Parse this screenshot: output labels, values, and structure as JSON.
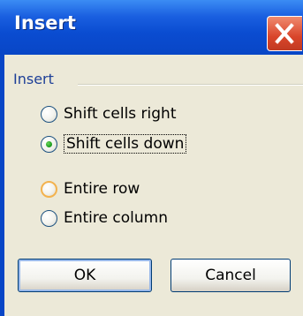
{
  "window": {
    "title": "Insert"
  },
  "titlebar": {
    "close_icon": "close-x-icon"
  },
  "group": {
    "label": "Insert"
  },
  "options": [
    {
      "label": "Shift cells right",
      "selected": false
    },
    {
      "label": "Shift cells down",
      "selected": true
    },
    {
      "label": "Entire row",
      "selected": false
    },
    {
      "label": "Entire column",
      "selected": false
    }
  ],
  "buttons": {
    "ok_label": "OK",
    "cancel_label": "Cancel"
  },
  "colors": {
    "titlebar": "#0a4cd1",
    "close": "#d9452a",
    "face": "#ece9d8",
    "group_label": "#1d3f97",
    "radio_dot": "#21a121"
  }
}
